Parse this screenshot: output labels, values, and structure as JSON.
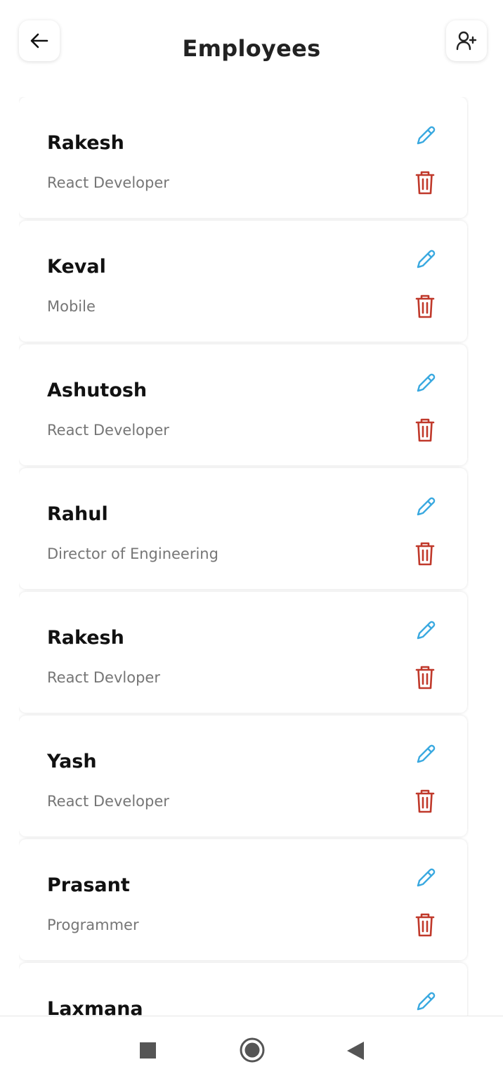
{
  "header": {
    "title": "Employees",
    "back_icon": "arrow-left-icon",
    "add_icon": "user-plus-icon"
  },
  "employees": [
    {
      "name": "Rakesh",
      "role": "React Developer"
    },
    {
      "name": "Keval",
      "role": "Mobile"
    },
    {
      "name": "Ashutosh",
      "role": "React Developer"
    },
    {
      "name": "Rahul",
      "role": "Director of Engineering"
    },
    {
      "name": "Rakesh",
      "role": "React Devloper"
    },
    {
      "name": "Yash",
      "role": "React Developer"
    },
    {
      "name": "Prasant",
      "role": "Programmer"
    },
    {
      "name": "Laxmana",
      "role": ""
    }
  ],
  "card_icons": {
    "edit": "pencil-icon",
    "delete": "trash-icon"
  },
  "colors": {
    "edit": "#3aa9e0",
    "delete": "#c0392b",
    "title": "#222222",
    "role": "#767676"
  },
  "navbar": {
    "items": [
      "recents-square-icon",
      "home-circle-icon",
      "back-triangle-icon"
    ]
  }
}
